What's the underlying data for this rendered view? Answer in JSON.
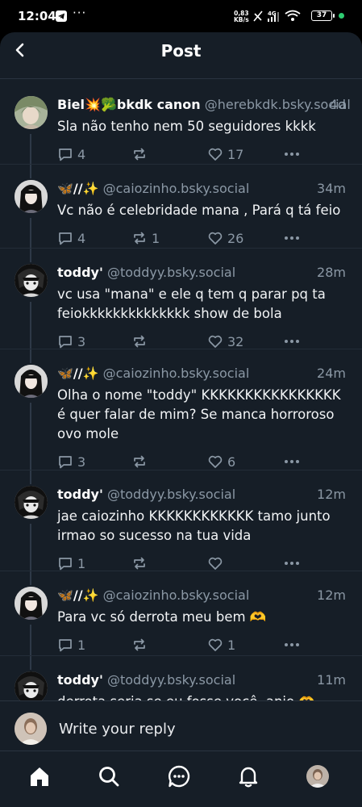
{
  "status_bar": {
    "time": "12:04",
    "more": "···",
    "speed_top": "0,83",
    "speed_bottom": "KB/s",
    "network": "4G",
    "battery": "37"
  },
  "header": {
    "title": "Post",
    "back_icon": "chevron-left-icon"
  },
  "posts": [
    {
      "display_name": "Biel💥🥦bkdk canon",
      "handle": "@herebkdk.bsky.social",
      "time": "4d",
      "text": "Sla não tenho nem 50 seguidores kkkk",
      "replies": "4",
      "reposts": "",
      "likes": "17"
    },
    {
      "display_name": "🦋//✨",
      "handle": "@caiozinho.bsky.social",
      "time": "34m",
      "text": "Vc não é celebridade mana , Pará q tá feio",
      "replies": "4",
      "reposts": "1",
      "likes": "26"
    },
    {
      "display_name": "toddy'",
      "handle": "@toddyy.bsky.social",
      "time": "28m",
      "text": "vc usa \"mana\" e ele q tem q parar pq ta feiokkkkkkkkkkkkkk show de bola",
      "replies": "3",
      "reposts": "",
      "likes": "32"
    },
    {
      "display_name": "🦋//✨",
      "handle": "@caiozinho.bsky.social",
      "time": "24m",
      "text": "Olha o nome \"toddy\" KKKKKKKKKKKKKKKK é quer falar de mim? Se manca horroroso ovo mole",
      "replies": "3",
      "reposts": "",
      "likes": "6"
    },
    {
      "display_name": "toddy'",
      "handle": "@toddyy.bsky.social",
      "time": "12m",
      "text": "jae caiozinho KKKKKKKKKKKK tamo junto irmao so sucesso na tua vida",
      "replies": "1",
      "reposts": "",
      "likes": ""
    },
    {
      "display_name": "🦋//✨",
      "handle": "@caiozinho.bsky.social",
      "time": "12m",
      "text": "Para vc só derrota meu bem 🫶",
      "replies": "1",
      "reposts": "",
      "likes": "1"
    },
    {
      "display_name": "toddy'",
      "handle": "@toddyy.bsky.social",
      "time": "11m",
      "text": "derrota seria se eu fosse você, anjo 🫶",
      "replies": "",
      "reposts": "",
      "likes": ""
    }
  ],
  "reply_bar": {
    "placeholder": "Write your reply"
  },
  "nav": [
    "home-icon",
    "search-icon",
    "chat-icon",
    "bell-icon",
    "profile-avatar"
  ],
  "colors": {
    "background": "#161e27",
    "muted": "#8b98a5",
    "thread_line": "#2e3947"
  }
}
